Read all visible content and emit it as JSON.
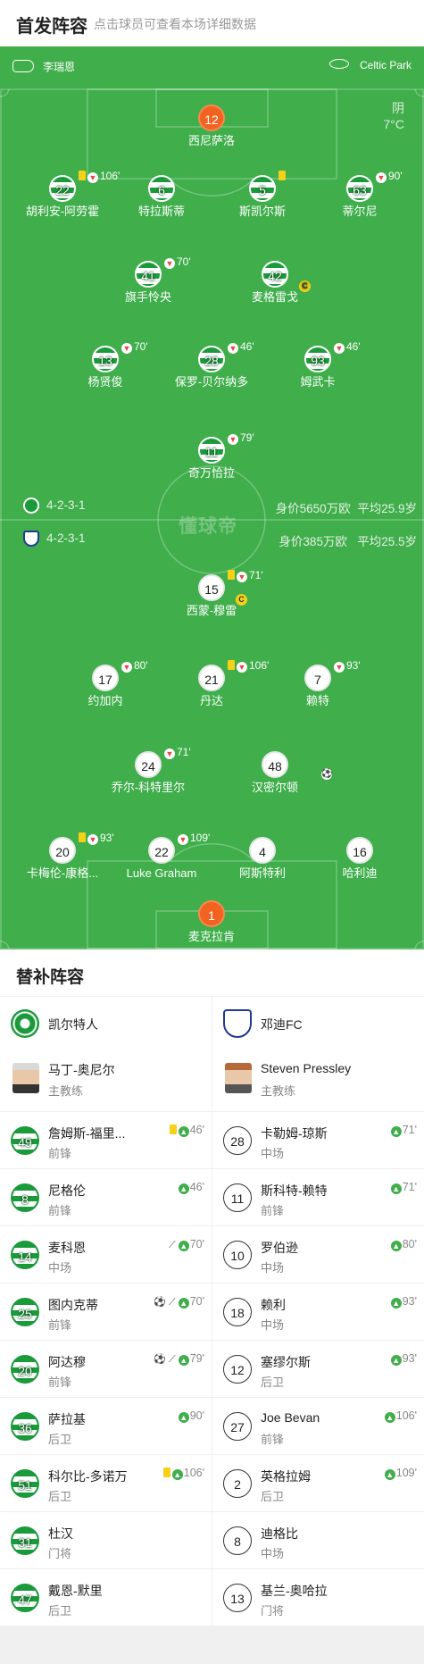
{
  "header": {
    "title": "首发阵容",
    "subtitle": "点击球员可查看本场详细数据"
  },
  "pitch": {
    "referee": "李瑞恩",
    "venue": "Celtic Park",
    "weather": "阴",
    "temperature": "7°C",
    "watermark": "懂球帝",
    "home_form": {
      "formation": "4-2-3-1",
      "value": "身价5650万欧",
      "age": "平均25.9岁"
    },
    "away_form": {
      "formation": "4-2-3-1",
      "value": "身价385万欧",
      "age": "平均25.5岁"
    }
  },
  "home_players": [
    {
      "num": "12",
      "name": "西尼萨洛",
      "gk": true
    },
    {
      "num": "22",
      "name": "胡利安-阿劳霍",
      "card": true,
      "subout": "106'"
    },
    {
      "num": "6",
      "name": "特拉斯蒂"
    },
    {
      "num": "5",
      "name": "斯凯尔斯",
      "card": true
    },
    {
      "num": "63",
      "name": "蒂尔尼",
      "subout": "90'"
    },
    {
      "num": "41",
      "name": "旗手怜央",
      "subout": "70'"
    },
    {
      "num": "42",
      "name": "麦格雷戈",
      "captain": true
    },
    {
      "num": "13",
      "name": "杨贤俊",
      "subout": "70'"
    },
    {
      "num": "28",
      "name": "保罗-贝尔纳多",
      "subout": "46'"
    },
    {
      "num": "93",
      "name": "姆武卡",
      "subout": "46'"
    },
    {
      "num": "11",
      "name": "奇万恰拉",
      "subout": "79'"
    }
  ],
  "away_players": [
    {
      "num": "15",
      "name": "西蒙-穆雷",
      "card": true,
      "subout": "71'",
      "captain": true
    },
    {
      "num": "17",
      "name": "约加内",
      "subout": "80'"
    },
    {
      "num": "21",
      "name": "丹达",
      "card": true,
      "subout": "106'"
    },
    {
      "num": "7",
      "name": "赖特",
      "subout": "93'"
    },
    {
      "num": "24",
      "name": "乔尔-科特里尔",
      "subout": "71'"
    },
    {
      "num": "48",
      "name": "汉密尔顿",
      "goal": true
    },
    {
      "num": "20",
      "name": "卡梅伦-康格...",
      "card": true,
      "subout": "93'",
      "assist": true
    },
    {
      "num": "22",
      "name": "Luke Graham",
      "subout": "109'"
    },
    {
      "num": "4",
      "name": "阿斯特利"
    },
    {
      "num": "16",
      "name": "哈利迪"
    },
    {
      "num": "1",
      "name": "麦克拉肯",
      "gk": true
    }
  ],
  "subs": {
    "title": "替补阵容",
    "home": {
      "team": "凯尔特人",
      "coach": {
        "name": "马丁-奥尼尔",
        "role": "主教练"
      },
      "players": [
        {
          "num": "49",
          "name": "詹姆斯-福里...",
          "pos": "前锋",
          "events": "46'",
          "card": true
        },
        {
          "num": "8",
          "name": "尼格伦",
          "pos": "前锋",
          "events": "46'"
        },
        {
          "num": "14",
          "name": "麦科恩",
          "pos": "中场",
          "events": "70'",
          "assist": true
        },
        {
          "num": "25",
          "name": "图内克蒂",
          "pos": "前锋",
          "events": "70'",
          "goal": true,
          "assist": true
        },
        {
          "num": "20",
          "name": "阿达穆",
          "pos": "前锋",
          "events": "79'",
          "goal": true,
          "assist": true
        },
        {
          "num": "36",
          "name": "萨拉基",
          "pos": "后卫",
          "events": "90'"
        },
        {
          "num": "51",
          "name": "科尔比-多诺万",
          "pos": "后卫",
          "events": "106'",
          "card": true
        },
        {
          "num": "31",
          "name": "杜汉",
          "pos": "门将",
          "events": ""
        },
        {
          "num": "47",
          "name": "戴恩-默里",
          "pos": "后卫",
          "events": ""
        }
      ]
    },
    "away": {
      "team": "邓迪FC",
      "coach": {
        "name": "Steven Pressley",
        "role": "主教练"
      },
      "players": [
        {
          "num": "28",
          "name": "卡勒姆-琼斯",
          "pos": "中场",
          "events": "71'"
        },
        {
          "num": "11",
          "name": "斯科特-赖特",
          "pos": "前锋",
          "events": "71'"
        },
        {
          "num": "10",
          "name": "罗伯逊",
          "pos": "中场",
          "events": "80'"
        },
        {
          "num": "18",
          "name": "赖利",
          "pos": "中场",
          "events": "93'"
        },
        {
          "num": "12",
          "name": "塞缪尔斯",
          "pos": "后卫",
          "events": "93'"
        },
        {
          "num": "27",
          "name": "Joe Bevan",
          "pos": "前锋",
          "events": "106'"
        },
        {
          "num": "2",
          "name": "英格拉姆",
          "pos": "后卫",
          "events": "109'"
        },
        {
          "num": "8",
          "name": "迪格比",
          "pos": "中场",
          "events": ""
        },
        {
          "num": "13",
          "name": "基兰-奥哈拉",
          "pos": "门将",
          "events": ""
        }
      ]
    }
  },
  "colors": {
    "pitch": "#3fae4b",
    "home_stripe": "#1a9a3b",
    "gk": "#f26322",
    "card": "#f7d117",
    "sub_in": "#3fae4b",
    "sub_out": "#e94545"
  }
}
